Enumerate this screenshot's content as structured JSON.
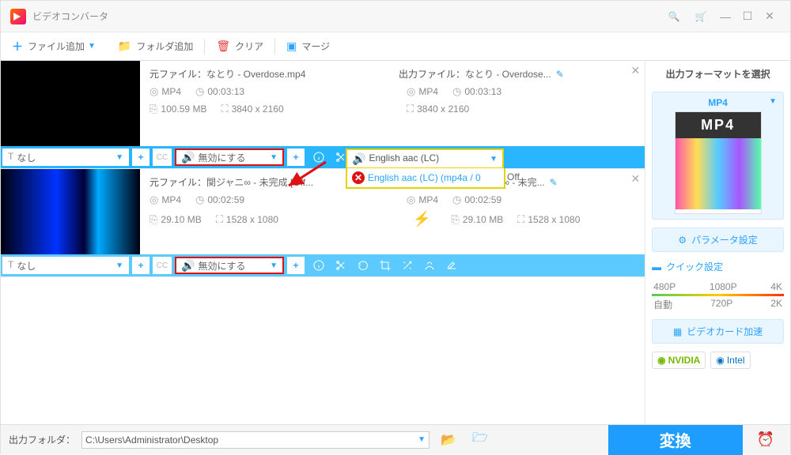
{
  "app": {
    "title": "ビデオコンバータ"
  },
  "toolbar": {
    "addFile": "ファイル追加",
    "addFolder": "フォルダ追加",
    "clear": "クリア",
    "merge": "マージ"
  },
  "items": [
    {
      "srcLabel": "元ファイル：",
      "srcName": "なとり - Overdose.mp4",
      "outLabel": "出力ファイル：",
      "outName": "なとり - Overdose...",
      "fmt": "MP4",
      "dur": "00:03:13",
      "size": "100.59 MB",
      "res": "3840 x 2160",
      "outFmt": "MP4",
      "outDur": "00:03:13",
      "outRes": "3840 x 2160",
      "subtitle": "なし",
      "audio": "無効にする",
      "audioSel": "English aac (LC)",
      "audioDrop": "English aac (LC) (mp4a / 0",
      "offTxt": "Off"
    },
    {
      "srcLabel": "元ファイル：",
      "srcName": "関ジャニ∞ - 未完成 [Off...",
      "outLabel": "出力ファイル：",
      "outName": "関ジャニ∞ - 未完...",
      "fmt": "MP4",
      "dur": "00:02:59",
      "size": "29.10 MB",
      "res": "1528 x 1080",
      "outFmt": "MP4",
      "outDur": "00:02:59",
      "outSize": "29.10 MB",
      "outRes": "1528 x 1080",
      "subtitle": "なし",
      "audio": "無効にする"
    }
  ],
  "side": {
    "fmtTitle": "出力フォーマットを選択",
    "fmt": "MP4",
    "fmtBadge": "MP4",
    "paramBtn": "パラメータ設定",
    "quick": "クイック設定",
    "r480": "480P",
    "r720": "720P",
    "r1080": "1080P",
    "r2k": "2K",
    "r4k": "4K",
    "auto": "自動",
    "gpuBtn": "ビデオカード加速",
    "nvidia": "NVIDIA",
    "intel": "Intel"
  },
  "footer": {
    "outLabel": "出力フォルダ：",
    "outPath": "C:\\Users\\Administrator\\Desktop",
    "convert": "変換"
  }
}
